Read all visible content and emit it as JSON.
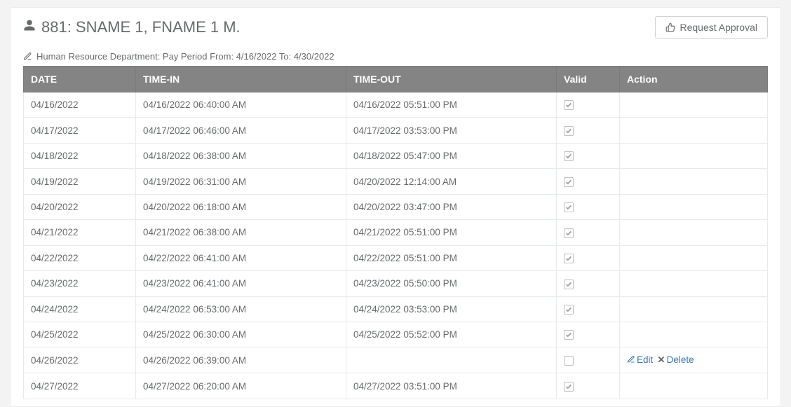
{
  "header": {
    "employee_title": "881: SNAME 1, FNAME 1 M.",
    "request_button": "Request Approval"
  },
  "caption": "Human Resource Department: Pay Period From: 4/16/2022 To: 4/30/2022",
  "columns": {
    "date": "DATE",
    "time_in": "TIME-IN",
    "time_out": "TIME-OUT",
    "valid": "Valid",
    "action": "Action"
  },
  "action_labels": {
    "edit": "Edit",
    "delete": "Delete"
  },
  "rows": [
    {
      "date": "04/16/2022",
      "in": "04/16/2022 06:40:00 AM",
      "out": "04/16/2022 05:51:00 PM",
      "valid": true,
      "actions": false
    },
    {
      "date": "04/17/2022",
      "in": "04/17/2022 06:46:00 AM",
      "out": "04/17/2022 03:53:00 PM",
      "valid": true,
      "actions": false
    },
    {
      "date": "04/18/2022",
      "in": "04/18/2022 06:38:00 AM",
      "out": "04/18/2022 05:47:00 PM",
      "valid": true,
      "actions": false
    },
    {
      "date": "04/19/2022",
      "in": "04/19/2022 06:31:00 AM",
      "out": "04/20/2022 12:14:00 AM",
      "valid": true,
      "actions": false
    },
    {
      "date": "04/20/2022",
      "in": "04/20/2022 06:18:00 AM",
      "out": "04/20/2022 03:47:00 PM",
      "valid": true,
      "actions": false
    },
    {
      "date": "04/21/2022",
      "in": "04/21/2022 06:38:00 AM",
      "out": "04/21/2022 05:51:00 PM",
      "valid": true,
      "actions": false
    },
    {
      "date": "04/22/2022",
      "in": "04/22/2022 06:41:00 AM",
      "out": "04/22/2022 05:51:00 PM",
      "valid": true,
      "actions": false
    },
    {
      "date": "04/23/2022",
      "in": "04/23/2022 06:41:00 AM",
      "out": "04/23/2022 05:50:00 PM",
      "valid": true,
      "actions": false
    },
    {
      "date": "04/24/2022",
      "in": "04/24/2022 06:53:00 AM",
      "out": "04/24/2022 03:53:00 PM",
      "valid": true,
      "actions": false
    },
    {
      "date": "04/25/2022",
      "in": "04/25/2022 06:30:00 AM",
      "out": "04/25/2022 05:52:00 PM",
      "valid": true,
      "actions": false
    },
    {
      "date": "04/26/2022",
      "in": "04/26/2022 06:39:00 AM",
      "out": "",
      "valid": false,
      "actions": true
    },
    {
      "date": "04/27/2022",
      "in": "04/27/2022 06:20:00 AM",
      "out": "04/27/2022 03:51:00 PM",
      "valid": true,
      "actions": false
    }
  ]
}
